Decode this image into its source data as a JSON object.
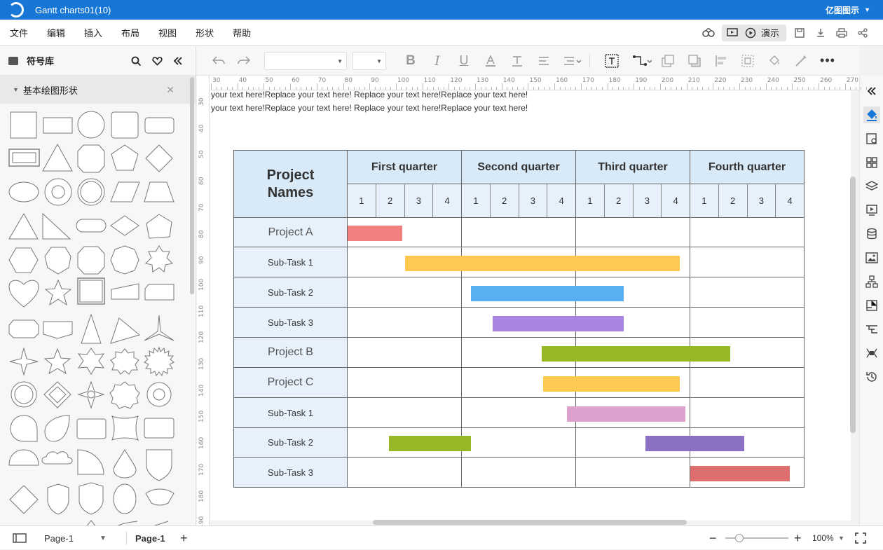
{
  "app": {
    "window_title": "Gantt charts01(10)",
    "brand": "亿图图示"
  },
  "menu": {
    "items": [
      "文件",
      "编辑",
      "插入",
      "布局",
      "视图",
      "形状",
      "帮助"
    ],
    "present_label": "演示"
  },
  "left_panel": {
    "title": "符号库",
    "section_title": "基本绘图形状"
  },
  "ruler": {
    "h_labels": [
      "30",
      "40",
      "50",
      "60",
      "70",
      "80",
      "90",
      "100",
      "110",
      "120",
      "130",
      "140",
      "150",
      "160",
      "170",
      "180",
      "190",
      "200",
      "210",
      "220",
      "230",
      "240",
      "250",
      "260",
      "270"
    ],
    "v_labels": [
      "30",
      "40",
      "50",
      "60",
      "70",
      "80",
      "90",
      "100",
      "110",
      "120",
      "130",
      "140",
      "150",
      "160",
      "170",
      "180",
      "190"
    ]
  },
  "canvas": {
    "text_line_1": "your text here!Replace your text here!    Replace your text here!Replace your text here!",
    "text_line_2": "your text here!Replace your text here!    Replace your text here!Replace your text here!"
  },
  "gantt": {
    "corner_label": "Project Names",
    "quarters": [
      "First quarter",
      "Second quarter",
      "Third quarter",
      "Fourth quarter"
    ],
    "weeks": [
      "1",
      "2",
      "3",
      "4"
    ],
    "rows": [
      {
        "name": "Project A",
        "kind": "project",
        "bar_start": 0.0,
        "bar_end": 0.48,
        "color": "#f47f7f"
      },
      {
        "name": "Sub-Task 1",
        "kind": "subtask",
        "bar_start": 0.5,
        "bar_end": 2.91,
        "color": "#ffc850"
      },
      {
        "name": "Sub-Task 2",
        "kind": "subtask",
        "bar_start": 1.08,
        "bar_end": 2.42,
        "color": "#5aaff0"
      },
      {
        "name": "Sub-Task 3",
        "kind": "subtask",
        "bar_start": 1.27,
        "bar_end": 2.42,
        "color": "#a884e2"
      },
      {
        "name": "Project B",
        "kind": "project",
        "bar_start": 1.7,
        "bar_end": 3.35,
        "color": "#97b927"
      },
      {
        "name": "Project C",
        "kind": "project",
        "bar_start": 1.71,
        "bar_end": 2.91,
        "color": "#ffc850"
      },
      {
        "name": "Sub-Task 1",
        "kind": "subtask",
        "bar_start": 1.92,
        "bar_end": 2.96,
        "color": "#dca1cc"
      },
      {
        "name": "Sub-Task 2",
        "kind": "subtask",
        "bar_start": 0.36,
        "bar_end": 1.08,
        "bar2_start": 2.61,
        "bar2_end": 3.47,
        "color": "#97b927",
        "color2": "#8c70c4"
      },
      {
        "name": "Sub-Task 3",
        "kind": "subtask",
        "bar_start": 3.0,
        "bar_end": 3.87,
        "color": "#dc6e6e"
      }
    ]
  },
  "status": {
    "page_select": "Page-1",
    "page_tab": "Page-1",
    "zoom": "100%"
  }
}
